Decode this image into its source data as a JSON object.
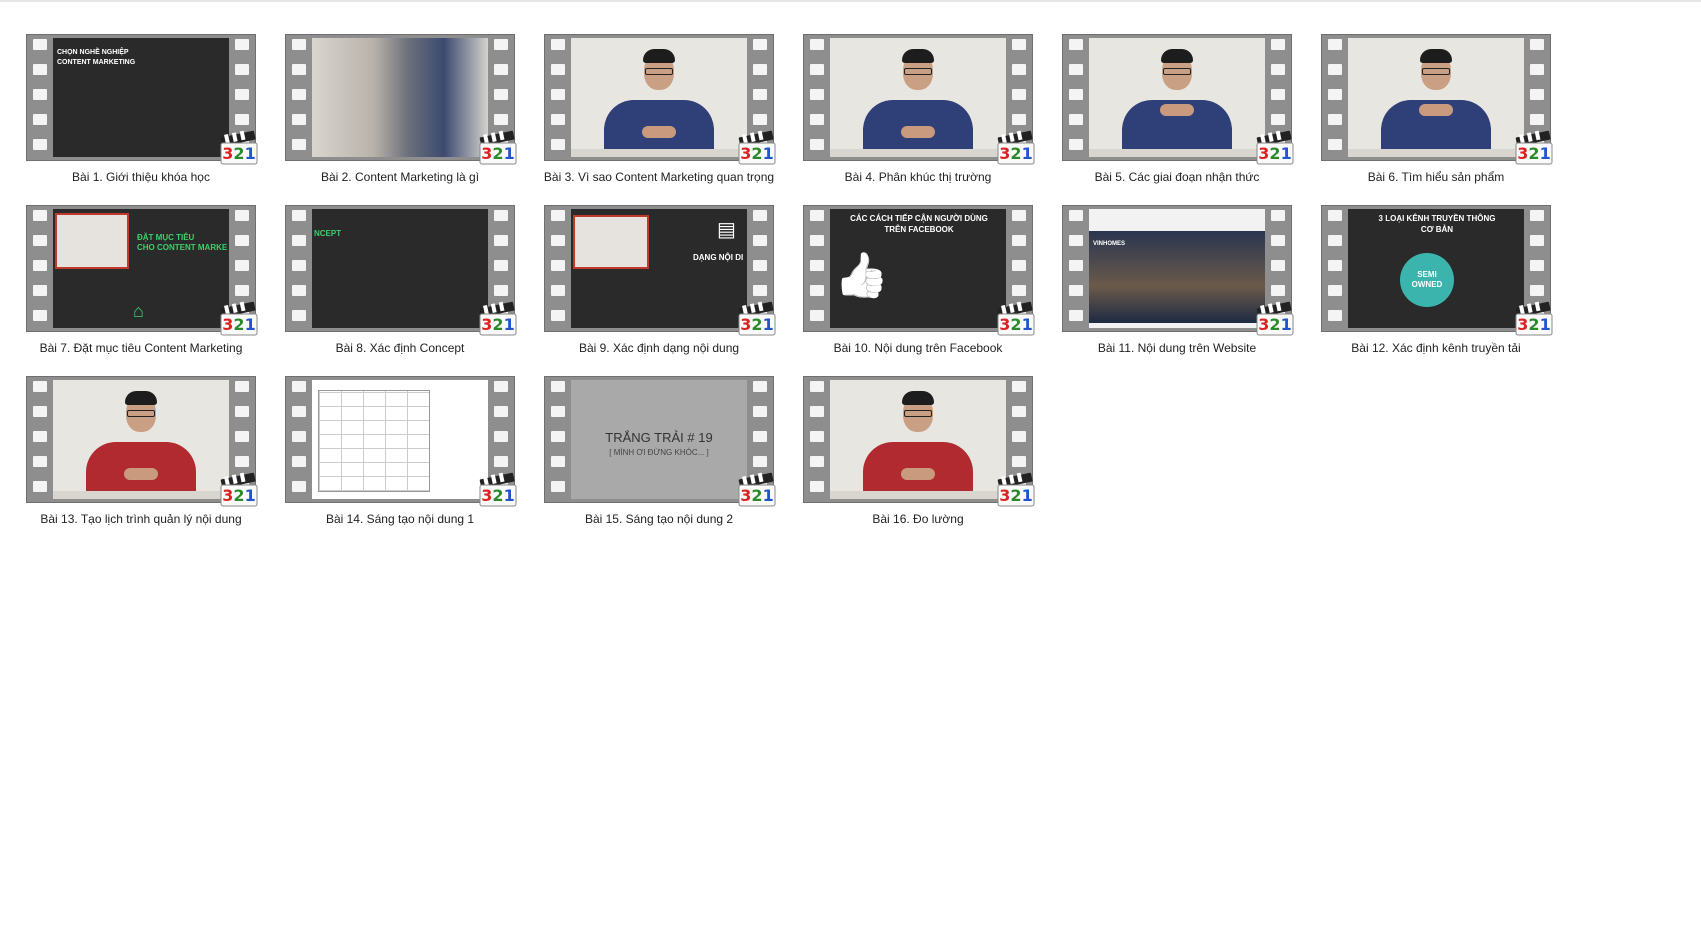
{
  "badge_text": "321",
  "lessons": [
    {
      "caption": "Bài 1. Giới thiệu khóa học",
      "slide": "CHỌN NGHỀ NGHIỆP\nCONTENT MARKETING"
    },
    {
      "caption": "Bài 2. Content Marketing là gì"
    },
    {
      "caption": "Bài 3. Vì sao Content Marketing quan trọng"
    },
    {
      "caption": "Bài 4. Phân khúc thị trường"
    },
    {
      "caption": "Bài 5. Các giai đoạn nhận thức"
    },
    {
      "caption": "Bài 6. Tìm hiểu sản phẩm"
    },
    {
      "caption": "Bài 7. Đặt mục tiêu Content Marketing",
      "slide": "ĐẶT MỤC TIÊU\nCHO CONTENT MARKE"
    },
    {
      "caption": "Bài 8. Xác định Concept",
      "slide": "NCEPT"
    },
    {
      "caption": "Bài 9. Xác định dạng nội dung",
      "slide": "DẠNG NỘI DI"
    },
    {
      "caption": "Bài 10. Nội dung trên Facebook",
      "slide": "CÁC CÁCH TIẾP CẬN NGƯỜI DÙNG\nTRÊN FACEBOOK"
    },
    {
      "caption": "Bài 11. Nội dung trên Website",
      "slide": "VINHOMES"
    },
    {
      "caption": "Bài 12. Xác định kênh truyền tải",
      "slide": "3 LOẠI KÊNH TRUYỀN THÔNG\nCƠ BẢN",
      "slide2": "SEMI\nOWNED"
    },
    {
      "caption": "Bài 13. Tạo lịch trình quản lý nội dung"
    },
    {
      "caption": "Bài 14. Sáng tạo nội dung 1"
    },
    {
      "caption": "Bài 15. Sáng tạo nội dung 2",
      "slide": "TRẮNG TRẢI # 19",
      "slide2": "[ MÌNH ƠI ĐỪNG KHÓC... ]"
    },
    {
      "caption": "Bài 16. Đo lường"
    }
  ]
}
